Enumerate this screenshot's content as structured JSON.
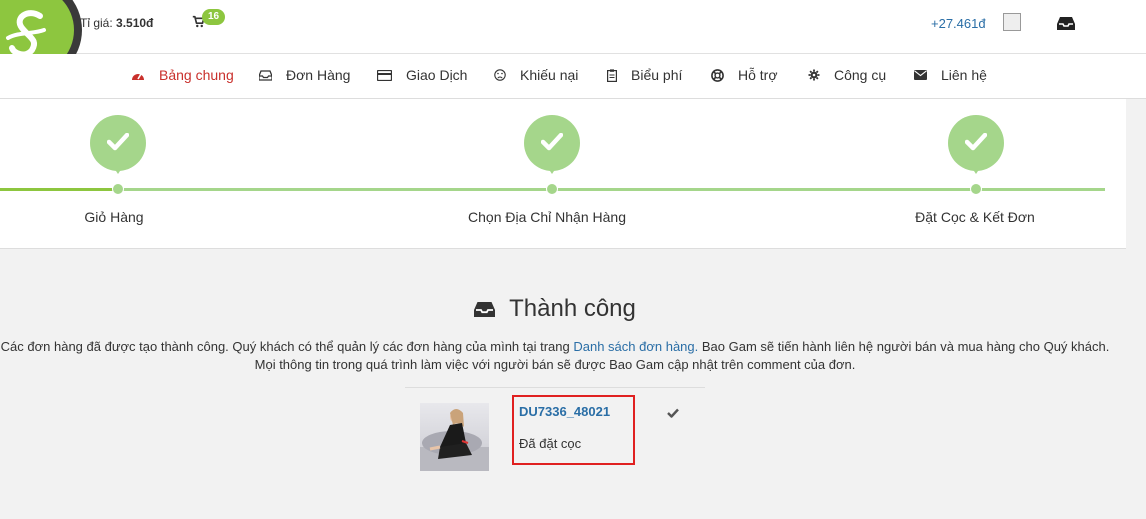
{
  "header": {
    "rate_label": "Tỉ giá: ",
    "rate_value": "3.510đ",
    "cart_count": "16",
    "balance": "+27.461đ"
  },
  "nav": {
    "items": [
      {
        "label": "Bảng chung",
        "icon": "dashboard-icon"
      },
      {
        "label": "Đơn Hàng",
        "icon": "inbox-icon"
      },
      {
        "label": "Giao Dịch",
        "icon": "credit-card-icon"
      },
      {
        "label": "Khiếu nại",
        "icon": "frown-icon"
      },
      {
        "label": "Biểu phí",
        "icon": "clipboard-icon"
      },
      {
        "label": "Hỗ trợ",
        "icon": "life-ring-icon"
      },
      {
        "label": "Công cụ",
        "icon": "gear-icon"
      },
      {
        "label": "Liên hệ",
        "icon": "envelope-icon"
      }
    ],
    "active_color": "#c9302c"
  },
  "steps": [
    {
      "label": "Giỏ Hàng"
    },
    {
      "label": "Chọn Địa Chỉ Nhận Hàng"
    },
    {
      "label": "Đặt Cọc & Kết Đơn"
    }
  ],
  "success": {
    "title": "Thành công",
    "line1_before": "Các đơn hàng đã được tạo thành công. Quý khách có thể quản lý các đơn hàng của mình tại trang ",
    "line1_link": "Danh sách đơn hàng.",
    "line1_after": " Bao Gam sẽ tiến hành liên hệ người bán và mua hàng cho Quý khách.",
    "line2": "Mọi thông tin trong quá trình làm việc với người bán sẽ được Bao Gam cập nhật trên comment của đơn."
  },
  "order": {
    "code": "DU7336_48021",
    "status": "Đã đặt cọc"
  },
  "colors": {
    "accent_green": "#8dc63f",
    "step_green": "#a5d68b",
    "link_blue": "#2a6ea6",
    "highlight_red": "#e02020"
  }
}
